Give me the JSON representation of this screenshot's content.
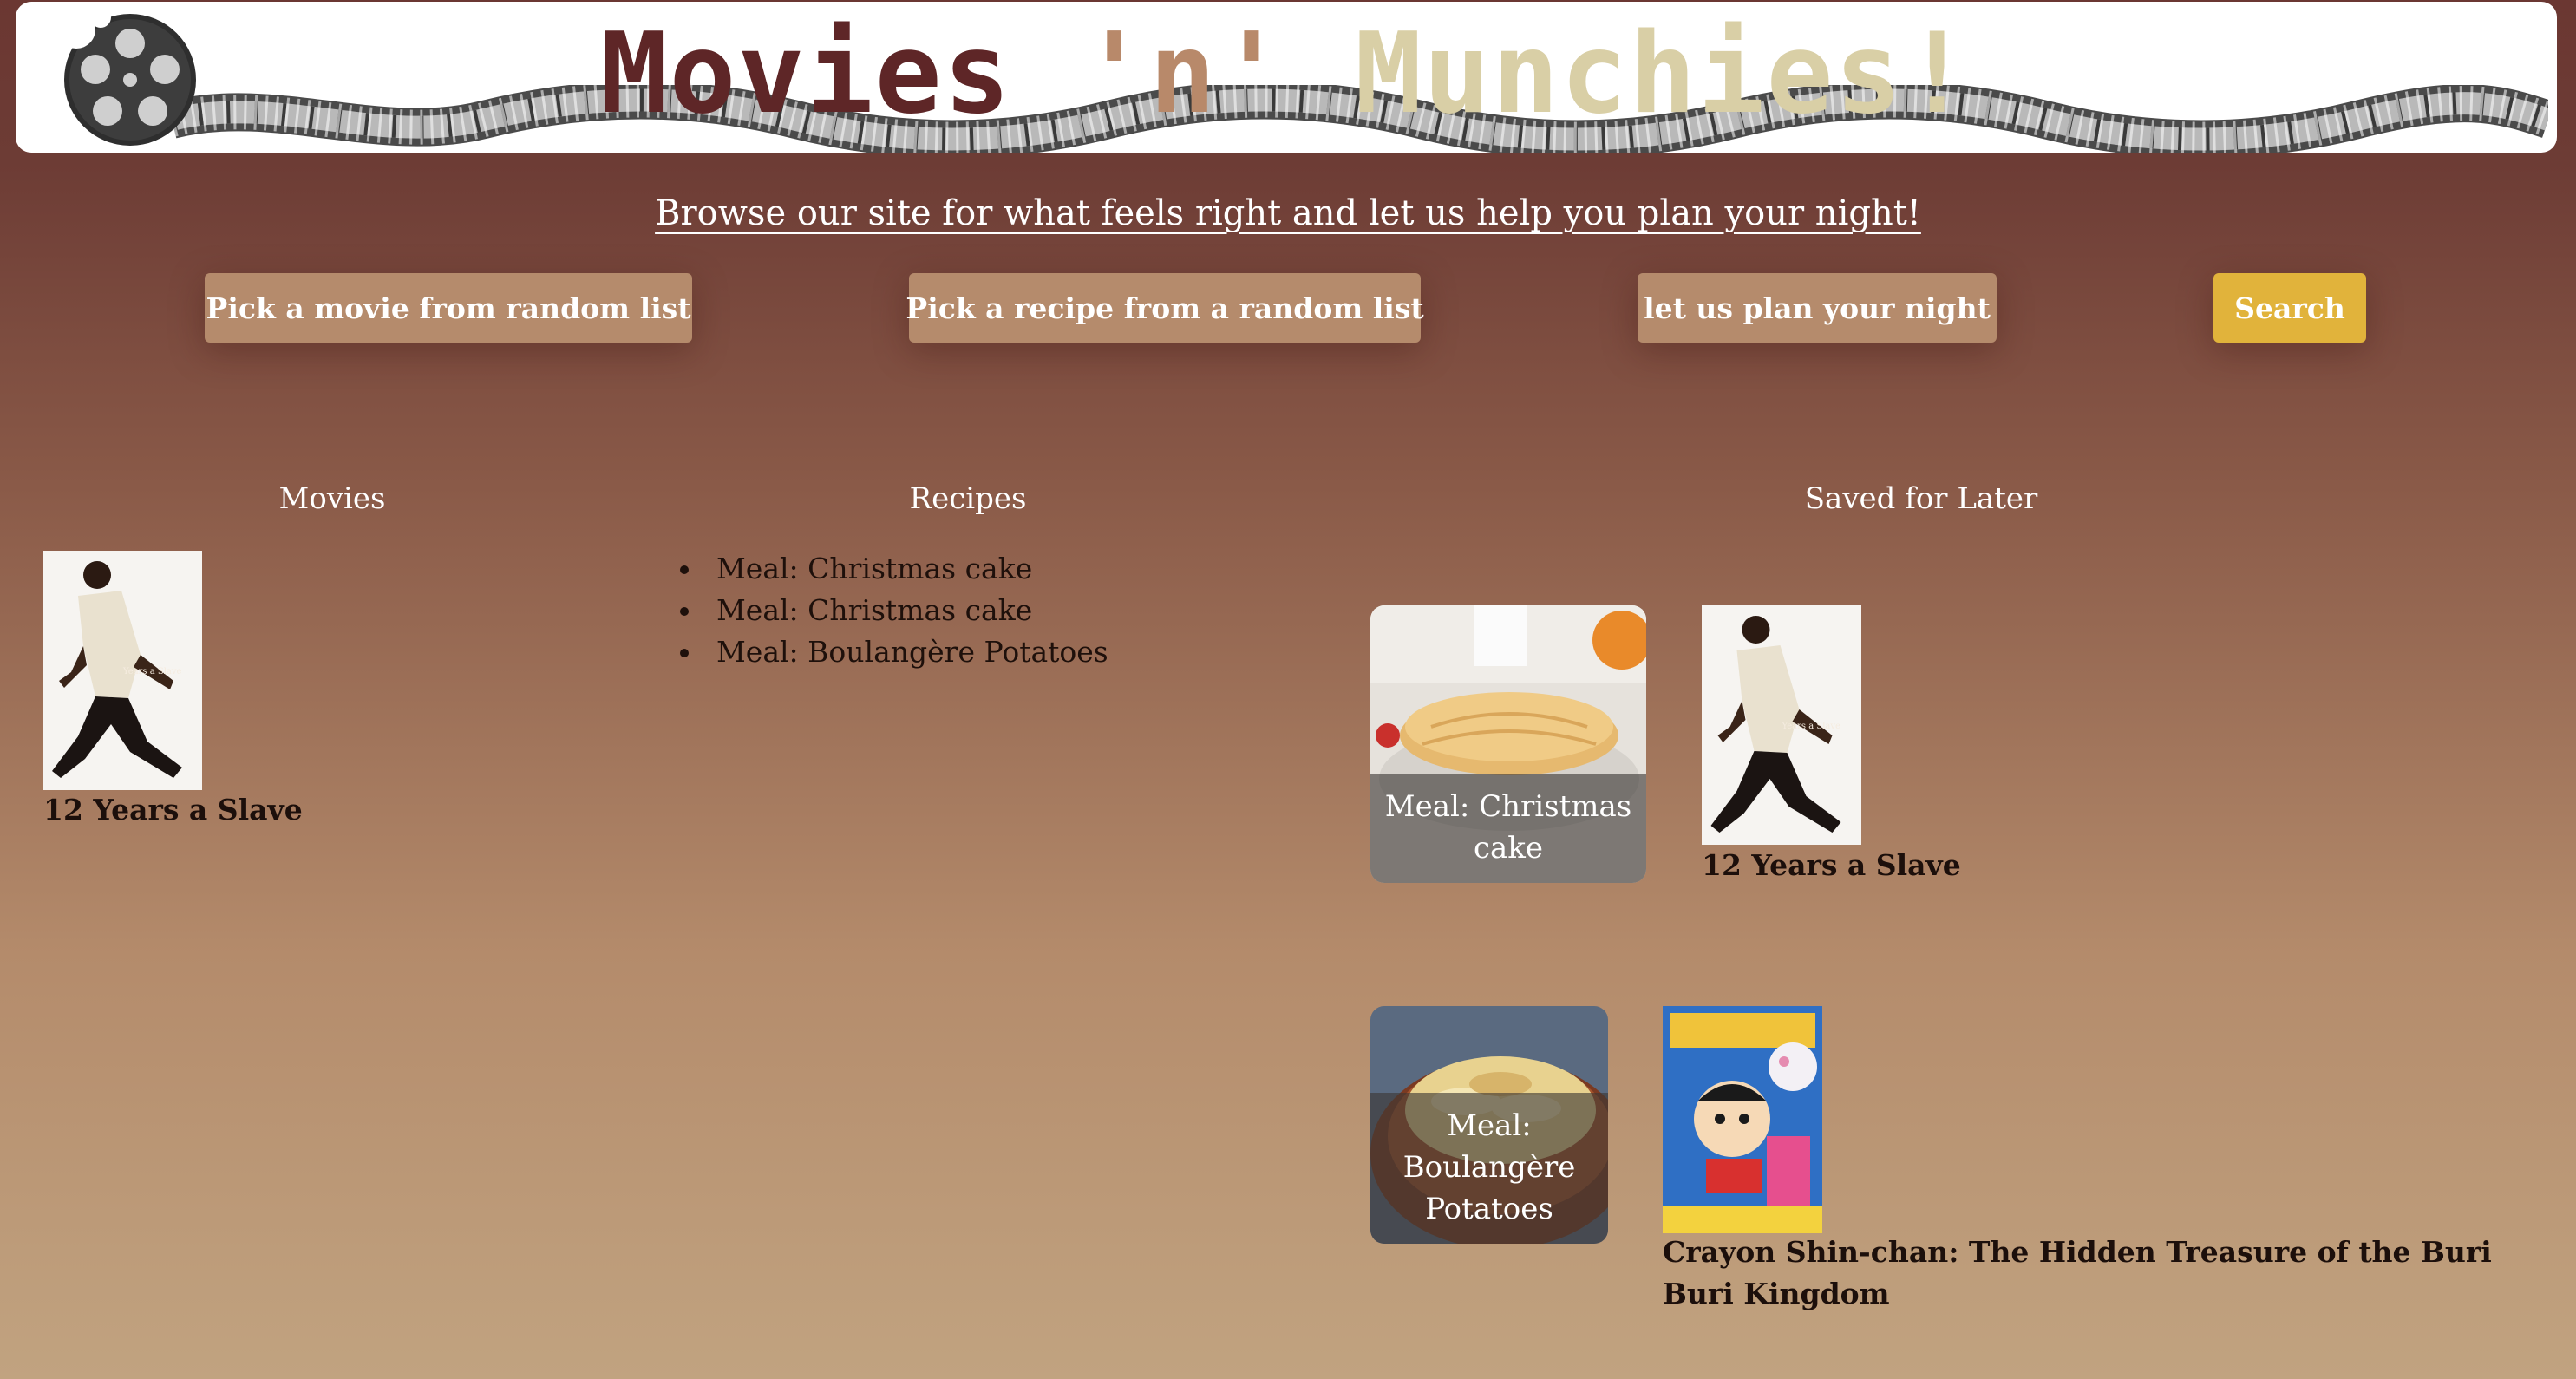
{
  "header": {
    "title_part1": "Movies",
    "title_part2": "'n'",
    "title_part3": "Munchies!",
    "logo_icon": "film-reel-icon"
  },
  "tagline": "Browse our site for what feels right and let us help you plan your night!",
  "buttons": {
    "random_movie": "Pick a movie from random list",
    "random_recipe": "Pick a recipe from a random list",
    "plan_night": "let us plan your night",
    "search": "Search"
  },
  "sections": {
    "movies_heading": "Movies",
    "recipes_heading": "Recipes",
    "saved_heading": "Saved for Later"
  },
  "movies": [
    {
      "title": "12 Years a Slave"
    }
  ],
  "recipes": [
    "Meal: Christmas cake",
    "Meal: Christmas cake",
    "Meal: Boulangère Potatoes"
  ],
  "saved": {
    "recipes": [
      {
        "caption": "Meal: Christmas cake"
      },
      {
        "caption": "Meal: Boulangère Potatoes"
      }
    ],
    "movies": [
      {
        "title": "12 Years a Slave"
      },
      {
        "title": "Crayon Shin-chan: The Hidden Treasure of the Buri Buri Kingdom"
      }
    ]
  },
  "colors": {
    "title_dark": "#5e2627",
    "title_mid": "#b8896a",
    "title_light": "#d9cfa6",
    "button_tan": "#b58b6c",
    "button_gold": "#e1b33b"
  }
}
